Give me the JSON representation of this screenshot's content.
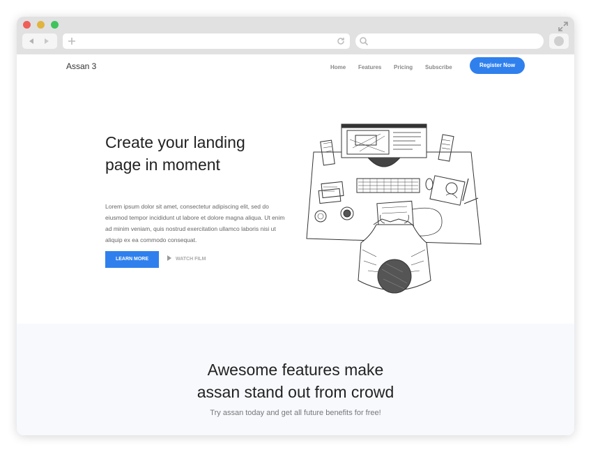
{
  "nav": {
    "brand": "Assan 3",
    "menu": [
      "Home",
      "Features",
      "Pricing",
      "Subscribe"
    ],
    "cta": "Register Now"
  },
  "hero": {
    "title_line1": "Create your landing",
    "title_line2": "page in moment",
    "body": "Lorem ipsum dolor sit amet, consectetur adipiscing elit, sed do eiusmod tempor incididunt ut labore et dolore magna aliqua. Ut enim ad minim veniam, quis nostrud exercitation ullamco laboris nisi ut aliquip ex ea commodo consequat.",
    "learn_more": "LEARN MORE",
    "watch_film": "WATCH FILM"
  },
  "features": {
    "title_line1": "Awesome features make",
    "title_line2": "assan stand out from crowd",
    "subtitle": "Try assan today and get all future benefits for free!"
  },
  "colors": {
    "accent": "#2f80ed",
    "features_bg": "#f7f9fd"
  }
}
